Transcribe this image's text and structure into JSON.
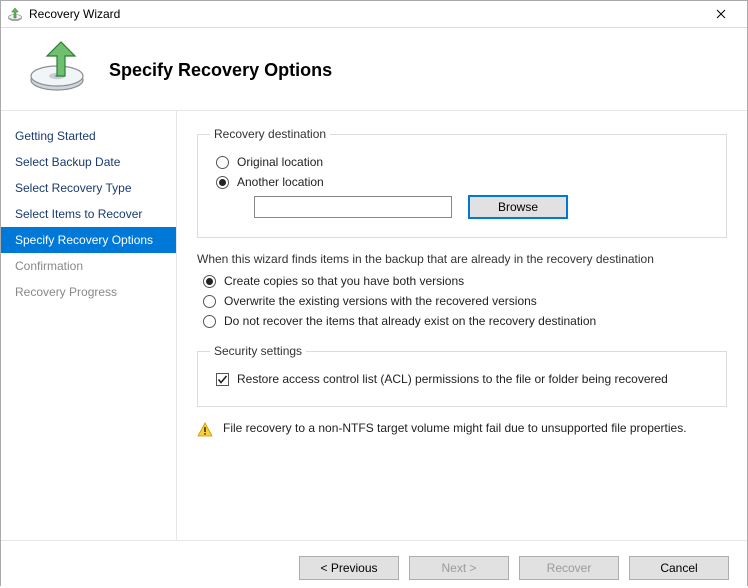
{
  "window": {
    "title": "Recovery Wizard"
  },
  "header": {
    "heading": "Specify Recovery Options"
  },
  "sidebar": {
    "steps": [
      {
        "label": "Getting Started",
        "state": "visited"
      },
      {
        "label": "Select Backup Date",
        "state": "visited"
      },
      {
        "label": "Select Recovery Type",
        "state": "visited"
      },
      {
        "label": "Select Items to Recover",
        "state": "visited"
      },
      {
        "label": "Specify Recovery Options",
        "state": "current"
      },
      {
        "label": "Confirmation",
        "state": "future"
      },
      {
        "label": "Recovery Progress",
        "state": "future"
      }
    ]
  },
  "destination": {
    "legend": "Recovery destination",
    "original_label": "Original location",
    "original_checked": false,
    "another_label": "Another location",
    "another_checked": true,
    "path_value": "",
    "browse_label": "Browse"
  },
  "conflict": {
    "prompt": "When this wizard finds items in the backup that are already in the recovery destination",
    "copies_label": "Create copies so that you have both versions",
    "copies_checked": true,
    "overwrite_label": "Overwrite the existing versions with the recovered versions",
    "overwrite_checked": false,
    "skip_label": "Do not recover the items that already exist on the recovery destination",
    "skip_checked": false
  },
  "security": {
    "legend": "Security settings",
    "acl_label": "Restore access control list (ACL) permissions to the file or folder being recovered",
    "acl_checked": true
  },
  "warning": {
    "text": "File recovery to a non-NTFS target volume might fail due to unsupported file properties."
  },
  "footer": {
    "previous": "< Previous",
    "next": "Next >",
    "recover": "Recover",
    "cancel": "Cancel",
    "next_enabled": false,
    "recover_enabled": false
  }
}
